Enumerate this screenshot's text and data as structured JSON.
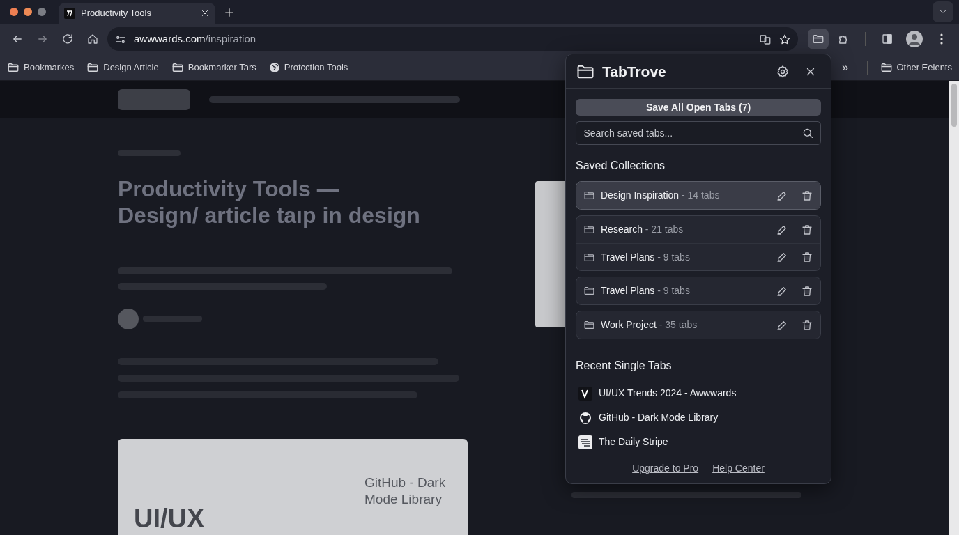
{
  "browser": {
    "tabs": [
      {
        "title": "Productivity Tools",
        "selected": true
      }
    ],
    "address": {
      "domain": "awwwards.com",
      "path": "/inspiration"
    },
    "bookmarks": [
      {
        "label": "Bookmarkes",
        "kind": "folder"
      },
      {
        "label": "Design Article",
        "kind": "folder"
      },
      {
        "label": "Bookmarker Tars",
        "kind": "folder"
      },
      {
        "label": "Protcction Tools",
        "kind": "globe"
      }
    ],
    "other_bookmarks": {
      "label": "Other Eelents"
    },
    "overflow": "»"
  },
  "page": {
    "headline": "Productivity Tools — Design/ article taıp in design",
    "card_title": "GitHub - Dark Mode Library",
    "card_big": "UI/UX"
  },
  "popup": {
    "title": "TabTrove",
    "save_button": "Save All Open Tabs (7)",
    "search": {
      "placeholder": "Search saved tabs..."
    },
    "collections_heading": "Saved Collections",
    "collection_groups": [
      {
        "items": [
          {
            "name": "Design Inspiration",
            "count": "- 14 tabs",
            "selected": true
          }
        ]
      },
      {
        "items": [
          {
            "name": "Research",
            "count": "- 21 tabs",
            "selected": false
          },
          {
            "name": "Travel Plans",
            "count": "- 9 tabs",
            "selected": false
          }
        ]
      },
      {
        "items": [
          {
            "name": "Travel Plans",
            "count": "- 9 tabs",
            "selected": false
          }
        ]
      },
      {
        "items": [
          {
            "name": "Work Project",
            "count": "- 35 tabs",
            "selected": false
          }
        ]
      }
    ],
    "recent_heading": "Recent Single Tabs",
    "recent": [
      {
        "title": "UI/UX Trends 2024 - Awwwards",
        "kind": "v"
      },
      {
        "title": "GitHub - Dark Mode Library",
        "kind": "github"
      },
      {
        "title": "The Daily Stripe",
        "kind": "stripe"
      }
    ],
    "footer_links": [
      "Upgrade to Pro",
      "Help Center"
    ]
  }
}
